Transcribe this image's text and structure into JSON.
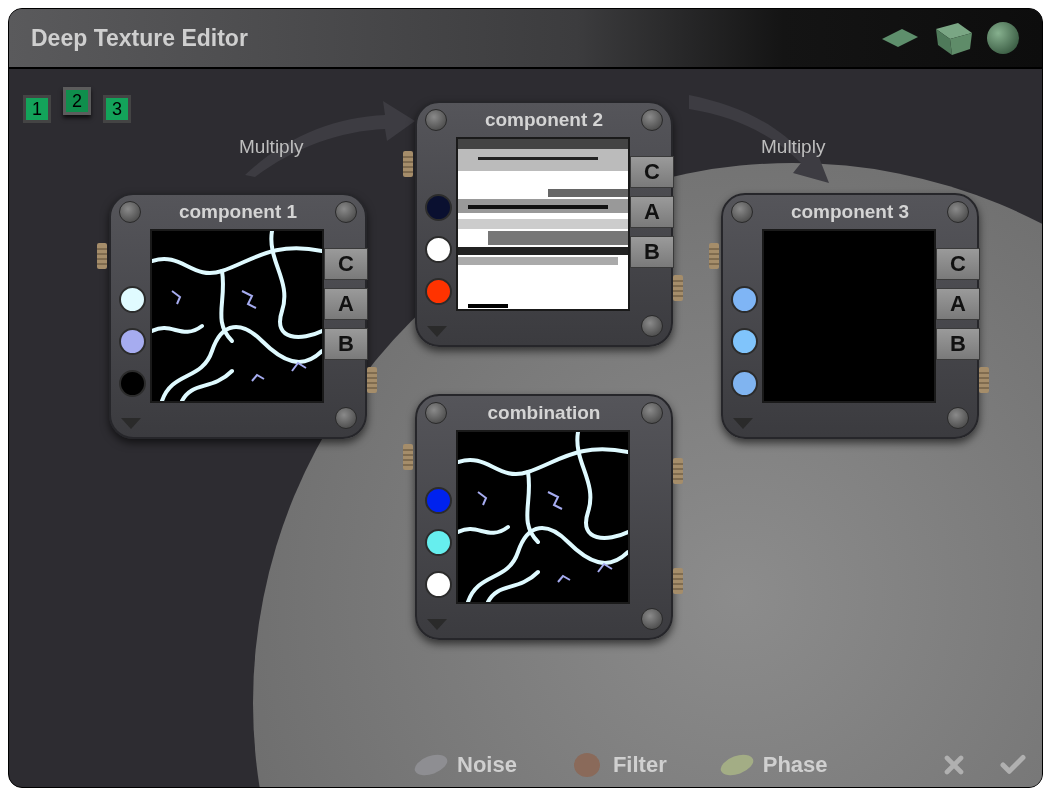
{
  "window": {
    "title": "Deep Texture Editor"
  },
  "view_icons": [
    {
      "kind": "plane"
    },
    {
      "kind": "cube"
    },
    {
      "kind": "sphere"
    }
  ],
  "component_tabs": [
    {
      "label": "1",
      "selected": false
    },
    {
      "label": "2",
      "selected": true
    },
    {
      "label": "3",
      "selected": false
    }
  ],
  "links": [
    {
      "label": "Multiply"
    },
    {
      "label": "Multiply"
    }
  ],
  "nodes": [
    {
      "title": "component 1",
      "preview": {
        "kind": "veins"
      },
      "swatches": [
        {
          "color": "#e0fbff"
        },
        {
          "color": "#a6acf0"
        },
        {
          "color": "#000000"
        }
      ],
      "channels": [
        "C",
        "A",
        "B"
      ]
    },
    {
      "title": "component 2",
      "preview": {
        "kind": "streaks"
      },
      "swatches": [
        {
          "color": "#0a1030"
        },
        {
          "color": "#ffffff"
        },
        {
          "color": "#ff3300"
        }
      ],
      "channels": [
        "C",
        "A",
        "B"
      ]
    },
    {
      "title": "component 3",
      "preview": {
        "kind": "blank"
      },
      "swatches": [
        {
          "color": "#7fb5f5"
        },
        {
          "color": "#80c4fb"
        },
        {
          "color": "#80b4f0"
        }
      ],
      "channels": [
        "C",
        "A",
        "B"
      ]
    },
    {
      "title": "combination",
      "preview": {
        "kind": "veins"
      },
      "swatches": [
        {
          "color": "#0022ee"
        },
        {
          "color": "#66eeee"
        },
        {
          "color": "#ffffff"
        }
      ]
    }
  ],
  "bottom_bar": {
    "buttons": [
      {
        "label": "Noise",
        "kind": "noise"
      },
      {
        "label": "Filter",
        "kind": "filter"
      },
      {
        "label": "Phase",
        "kind": "phase"
      }
    ]
  }
}
